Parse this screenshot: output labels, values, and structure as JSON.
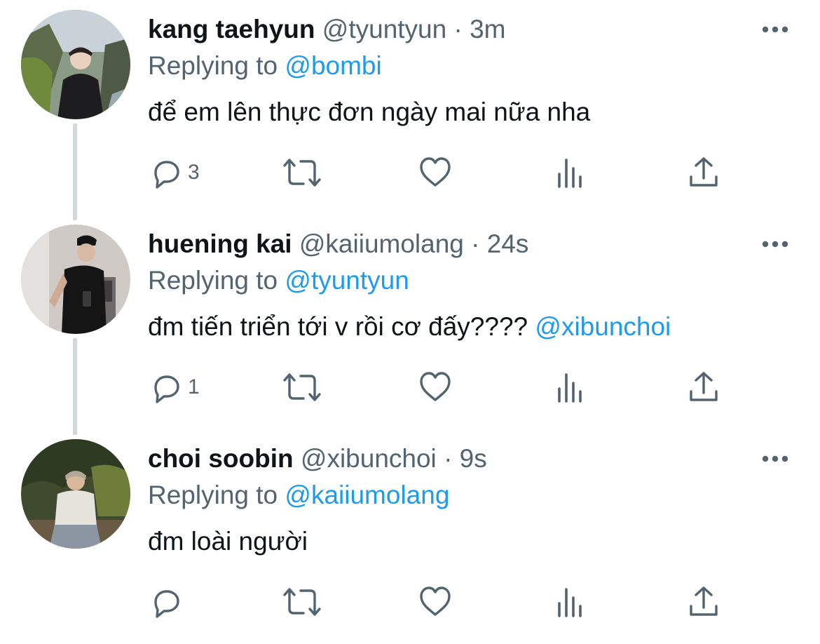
{
  "colors": {
    "link": "#1d9bf0",
    "meta": "#536471",
    "text": "#0f1419",
    "thread_line": "#cfd9de"
  },
  "tweets": [
    {
      "name": "kang taehyun",
      "handle": "@tyuntyun",
      "separator": "·",
      "time": "3m",
      "replying_label": "Replying to",
      "replying_to": "@bombi",
      "text": "để em lên thực đơn ngày mai nữa nha",
      "mention": "",
      "reply_count": "3",
      "icons": [
        "more-icon",
        "reply-icon",
        "retweet-icon",
        "like-icon",
        "analytics-icon",
        "share-icon"
      ]
    },
    {
      "name": "huening kai",
      "handle": "@kaiiumolang",
      "separator": "·",
      "time": "24s",
      "replying_label": "Replying to",
      "replying_to": "@tyuntyun",
      "text": "đm tiến triển tới v rồi cơ đấy????",
      "mention": "@xibunchoi",
      "reply_count": "1",
      "icons": [
        "more-icon",
        "reply-icon",
        "retweet-icon",
        "like-icon",
        "analytics-icon",
        "share-icon"
      ]
    },
    {
      "name": "choi soobin",
      "handle": "@xibunchoi",
      "separator": "·",
      "time": "9s",
      "replying_label": "Replying to",
      "replying_to": "@kaiiumolang",
      "text": "đm loài người",
      "mention": "",
      "reply_count": "",
      "icons": [
        "more-icon",
        "reply-icon",
        "retweet-icon",
        "like-icon",
        "analytics-icon",
        "share-icon"
      ]
    }
  ]
}
